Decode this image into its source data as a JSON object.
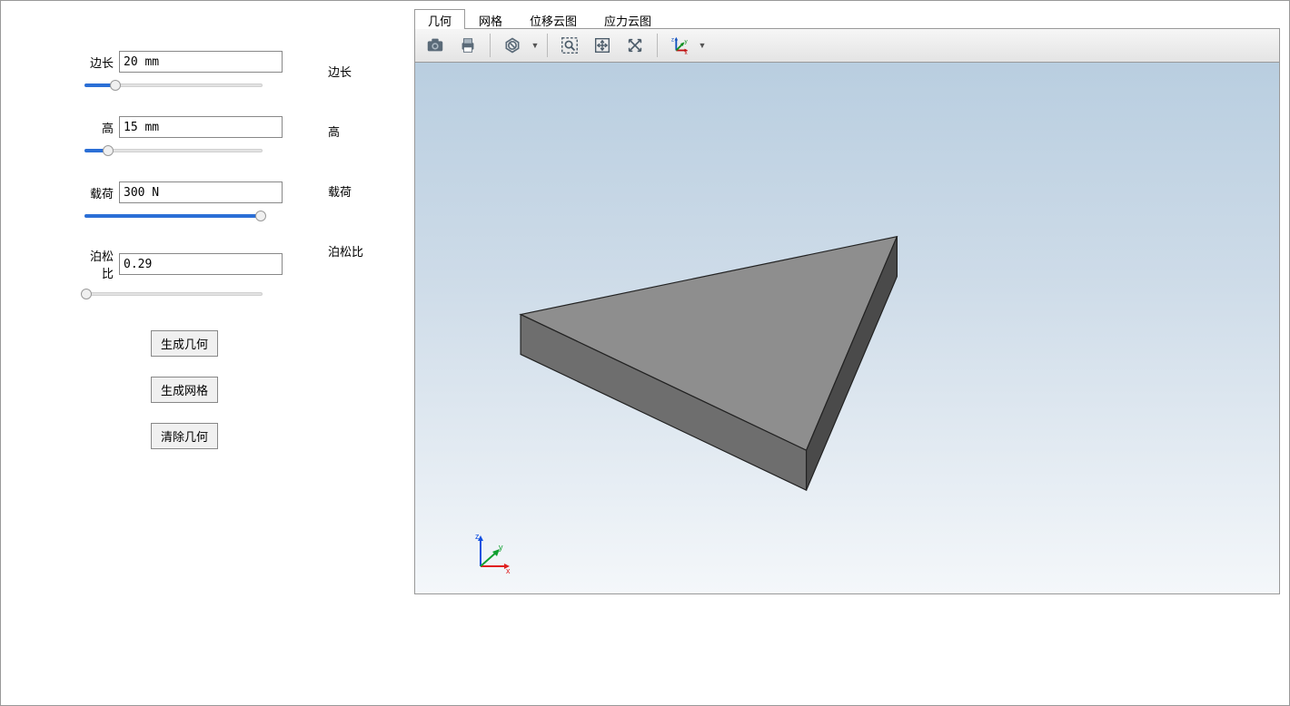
{
  "sidebar": {
    "params": [
      {
        "label": "边长",
        "value": "20 mm",
        "right_label": "边长",
        "slider_percent": 18
      },
      {
        "label": "高",
        "value": "15 mm",
        "right_label": "高",
        "slider_percent": 14
      },
      {
        "label": "载荷",
        "value": "300 N",
        "right_label": "载荷",
        "slider_percent": 98
      },
      {
        "label": "泊松比",
        "value": "0.29",
        "right_label": "泊松比",
        "slider_percent": 2
      }
    ],
    "buttons": {
      "gen_geom": "生成几何",
      "gen_mesh": "生成网格",
      "clear_geom": "清除几何"
    }
  },
  "tabs": [
    {
      "label": "几何",
      "active": true
    },
    {
      "label": "网格",
      "active": false
    },
    {
      "label": "位移云图",
      "active": false
    },
    {
      "label": "应力云图",
      "active": false
    }
  ],
  "toolbar": {
    "camera": "camera-icon",
    "print": "print-icon",
    "hexagon": "hexagon-icon",
    "zoombox": "zoom-box-icon",
    "fit": "fit-icon",
    "rotate": "rotate-icon",
    "axes": "axes-icon"
  },
  "axis": {
    "x": "x",
    "y": "y",
    "z": "z"
  }
}
